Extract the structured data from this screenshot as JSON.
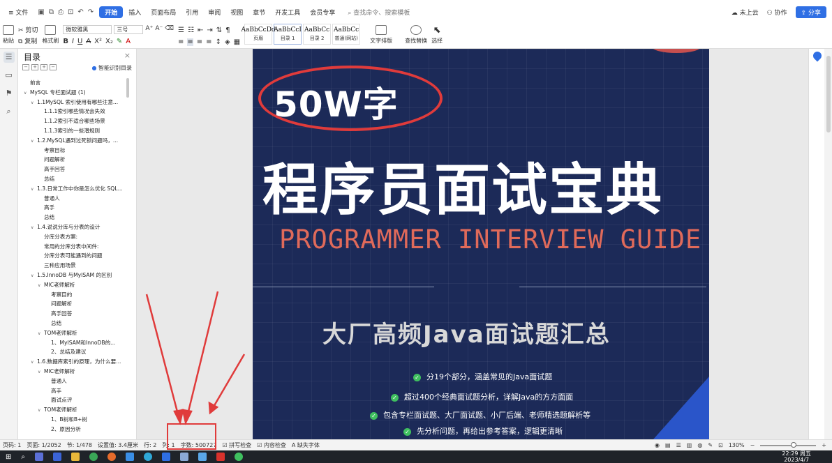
{
  "menu": {
    "file": "文件",
    "tabs": [
      "开始",
      "插入",
      "页面布局",
      "引用",
      "审阅",
      "视图",
      "章节",
      "开发工具",
      "会员专享"
    ],
    "search_placeholder": "查找命令、搜索模板",
    "cloud": "未上云",
    "collab": "协作",
    "share": "分享"
  },
  "ribbon": {
    "paste": "粘贴",
    "cut": "剪切",
    "copy": "复制",
    "format_painter": "格式刷",
    "font_name": "微软雅黑",
    "font_size": "三号",
    "styles": [
      {
        "preview": "AaBbCcDd",
        "name": "页眉"
      },
      {
        "preview": "AaBbCcI",
        "name": "目录 1"
      },
      {
        "preview": "AaBbCc",
        "name": "目录 2"
      },
      {
        "preview": "AaBbCc",
        "name": "普通(网站)"
      }
    ],
    "text_layout": "文字排版",
    "find_replace": "查找替换",
    "select": "选择"
  },
  "toc": {
    "title": "目录",
    "smart": "智能识别目录",
    "items": [
      {
        "level": 1,
        "text": "前言",
        "arrow": false
      },
      {
        "level": 1,
        "text": "MySQL 专栏面试题 (1)",
        "arrow": true
      },
      {
        "level": 2,
        "text": "1.1MySQL 索引使用有哪些注意...",
        "arrow": true
      },
      {
        "level": 3,
        "text": "1.1.1索引哪些情况会失效",
        "arrow": false
      },
      {
        "level": 3,
        "text": "1.1.2索引不适合哪些场景",
        "arrow": false
      },
      {
        "level": 3,
        "text": "1.1.3索引的一些潜规则",
        "arrow": false
      },
      {
        "level": 2,
        "text": "1.2.MySQL遇到过死锁问题吗，...",
        "arrow": true
      },
      {
        "level": 3,
        "text": "考察目标",
        "arrow": false
      },
      {
        "level": 3,
        "text": "问题解析",
        "arrow": false
      },
      {
        "level": 3,
        "text": "高手回答",
        "arrow": false
      },
      {
        "level": 3,
        "text": "总结",
        "arrow": false
      },
      {
        "level": 2,
        "text": "1.3.日常工作中你是怎么优化 SQL...",
        "arrow": true
      },
      {
        "level": 3,
        "text": "普通人",
        "arrow": false
      },
      {
        "level": 3,
        "text": "高手",
        "arrow": false
      },
      {
        "level": 3,
        "text": "总结",
        "arrow": false
      },
      {
        "level": 2,
        "text": "1.4.说说分库与分表的设计",
        "arrow": true
      },
      {
        "level": 3,
        "text": "分库分表方案:",
        "arrow": false
      },
      {
        "level": 3,
        "text": "常用的分库分表中间件:",
        "arrow": false
      },
      {
        "level": 3,
        "text": "分库分表可能遇到的问题",
        "arrow": false
      },
      {
        "level": 3,
        "text": "三种应用场景",
        "arrow": false
      },
      {
        "level": 2,
        "text": "1.5.InnoDB 与MyISAM 的区别",
        "arrow": true
      },
      {
        "level": 3,
        "text": "MIC老师解析",
        "arrow": true
      },
      {
        "level": 4,
        "text": "考察目的",
        "arrow": false
      },
      {
        "level": 4,
        "text": "问题解析",
        "arrow": false
      },
      {
        "level": 4,
        "text": "高手回答",
        "arrow": false
      },
      {
        "level": 4,
        "text": "总结",
        "arrow": false
      },
      {
        "level": 3,
        "text": "TOM老师解析",
        "arrow": true
      },
      {
        "level": 4,
        "text": "1、MyISAM和InnoDB的...",
        "arrow": false
      },
      {
        "level": 4,
        "text": "2、总结及建议",
        "arrow": false
      },
      {
        "level": 2,
        "text": "1.6.数据库索引的原理，为什么要...",
        "arrow": true
      },
      {
        "level": 3,
        "text": "MIC老师解析",
        "arrow": true
      },
      {
        "level": 4,
        "text": "普通人",
        "arrow": false
      },
      {
        "level": 4,
        "text": "高手",
        "arrow": false
      },
      {
        "level": 4,
        "text": "面试点评",
        "arrow": false
      },
      {
        "level": 3,
        "text": "TOM老师解析",
        "arrow": true
      },
      {
        "level": 4,
        "text": "1、B树和B+树",
        "arrow": false
      },
      {
        "level": 4,
        "text": "2、原因分析",
        "arrow": false
      }
    ]
  },
  "cover": {
    "badge": "50W字",
    "title": "程序员面试宝典",
    "subtitle_en": "PROGRAMMER INTERVIEW GUIDE",
    "subtitle_cn": "大厂高频Java面试题汇总",
    "bullets": [
      "分19个部分，涵盖常见的Java面试题",
      "超过400个经典面试题分析，详解Java的方方面面",
      "包含专栏面试题、大厂面试题、小厂后端、老师精选题解析等",
      "先分析问题，再给出参考答案，逻辑更清晰"
    ]
  },
  "status": {
    "page_num": "页码: 1",
    "pages": "页面: 1/2052",
    "section": "节: 1/478",
    "setting": "设置值: 3.4厘米",
    "row": "行: 2",
    "col": "列: 1",
    "word_count": "字数: 500727",
    "spell": "拼写检查",
    "content_check": "内容检查",
    "missing_font": "缺失字体",
    "zoom": "130%"
  },
  "taskbar": {
    "time": "22:29 周五",
    "date": "2023/4/7"
  },
  "colors": {
    "accent": "#2f6fe4",
    "cover_bg": "#1c2a58",
    "highlight_red": "#e03b3b",
    "subtitle_en": "#e06a5a"
  }
}
